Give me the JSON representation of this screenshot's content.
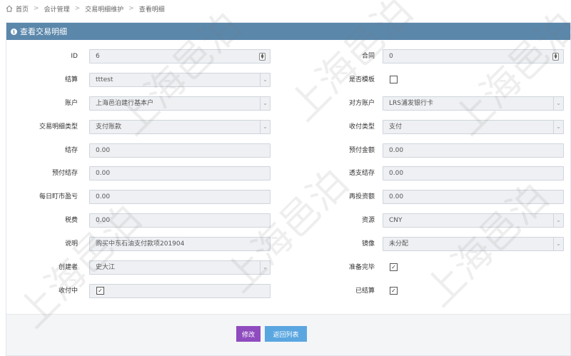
{
  "breadcrumb": {
    "items": [
      "首页",
      "会计管理",
      "交易明细维护",
      "查看明细"
    ],
    "separator": ">"
  },
  "panel": {
    "title": "查看交易明细"
  },
  "form": {
    "id": {
      "label": "ID",
      "value": "6"
    },
    "contract": {
      "label": "合同",
      "value": "0"
    },
    "settlement": {
      "label": "结算",
      "value": "tttest"
    },
    "is_template": {
      "label": "是否模板",
      "checked": false
    },
    "account": {
      "label": "账户",
      "value": "上海邑泊建行基本户"
    },
    "counter_account": {
      "label": "对方账户",
      "value": "LRS浦发银行卡"
    },
    "txn_type": {
      "label": "交易明细类型",
      "value": "支付账款"
    },
    "pay_type": {
      "label": "收付类型",
      "value": "支付"
    },
    "balance": {
      "label": "结存",
      "value": "0.00"
    },
    "prepay_amount": {
      "label": "预付金额",
      "value": "0.00"
    },
    "prepay_balance": {
      "label": "预付结存",
      "value": "0.00"
    },
    "overdraft_balance": {
      "label": "透支结存",
      "value": "0.00"
    },
    "daily_mtm": {
      "label": "每日盯市盈亏",
      "value": "0.00"
    },
    "reinvest_amount": {
      "label": "再投资额",
      "value": "0.00"
    },
    "tax": {
      "label": "税费",
      "value": "0.00"
    },
    "currency": {
      "label": "资源",
      "value": "CNY"
    },
    "description": {
      "label": "说明",
      "value": "购买中东石油支付款项201904"
    },
    "mirror": {
      "label": "镜像",
      "value": "未分配"
    },
    "creator": {
      "label": "创建者",
      "value": "史大江"
    },
    "ready": {
      "label": "准备完毕",
      "checked": true
    },
    "collecting": {
      "label": "收付中",
      "checked": true
    },
    "settled": {
      "label": "已结算",
      "checked": true
    }
  },
  "buttons": {
    "edit": "修改",
    "back": "返回列表"
  },
  "watermark": "上海邑泊",
  "colors": {
    "header": "#5b87ab",
    "edit_button": "#8f4cbf",
    "back_button": "#5aa6e0"
  }
}
